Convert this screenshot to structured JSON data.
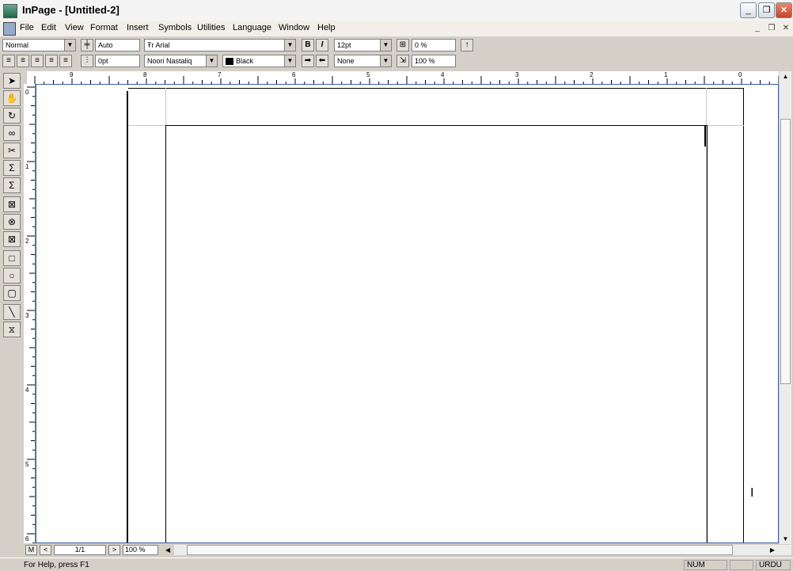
{
  "window": {
    "title": "InPage - [Untitled-2]"
  },
  "menubar": {
    "items": [
      "File",
      "Edit",
      "View",
      "Format",
      "Insert",
      "Symbols",
      "Utilities",
      "Language",
      "Window",
      "Help"
    ]
  },
  "toolbar": {
    "style": "Normal",
    "leading": "Auto",
    "spacing": "0pt",
    "latin_font": "Arial",
    "urdu_font": "Noori Nastaliq",
    "bold": "B",
    "italic": "I",
    "font_size": "12pt",
    "tracking": "0 %",
    "color": "Black",
    "color_hex": "#000000",
    "shade": "None",
    "scale": "100 %"
  },
  "ruler": {
    "h_labels": [
      "9",
      "8",
      "7",
      "6",
      "5",
      "4",
      "3",
      "2",
      "1",
      "0"
    ],
    "v_labels": [
      "0",
      "1",
      "2",
      "3",
      "4",
      "5",
      "6"
    ]
  },
  "navigation": {
    "master": "M",
    "prev": "<",
    "page": "1/1",
    "next": ">",
    "zoom": "100 %"
  },
  "status": {
    "help": "For Help, press F1",
    "num": "NUM",
    "language": "URDU"
  }
}
